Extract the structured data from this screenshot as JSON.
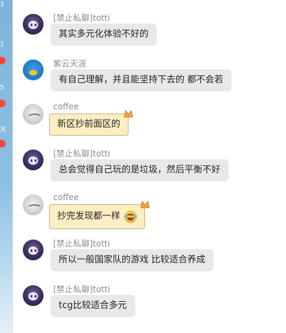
{
  "side": {
    "numbers": [
      "3",
      "1",
      "5",
      "天"
    ],
    "badge_color": "#f04a3a"
  },
  "messages": [
    {
      "nick": "[禁止私聊]totti",
      "text": "其实多元化体验不好的",
      "avatar": "purple-anime-avatar"
    },
    {
      "nick": "紫云天涯",
      "text": "有自己理解，并且能坚持下去的 都不会若",
      "avatar": "blue-bird-avatar"
    },
    {
      "nick": "coffee",
      "text": "新区抄前面区的",
      "avatar": "cat-avatar",
      "themed": true
    },
    {
      "nick": "[禁止私聊]totti",
      "text": "总会觉得自己玩的是垃圾，然后平衡不好",
      "avatar": "purple-anime-avatar"
    },
    {
      "nick": "coffee",
      "text": "抄完发现都一样",
      "avatar": "cat-avatar",
      "themed": true,
      "emoji": "laugh-cry-emoji"
    },
    {
      "nick": "[禁止私聊]totti",
      "text": "所以一般国家队的游戏 比较适合养成",
      "avatar": "purple-anime-avatar"
    },
    {
      "nick": "[禁止私聊]totti",
      "text": "tcg比较适合多元",
      "avatar": "purple-anime-avatar"
    }
  ],
  "colors": {
    "bubble": "#e8e8e8",
    "themed_bubble": "#fbeec2",
    "nick": "#8c8c8c"
  }
}
